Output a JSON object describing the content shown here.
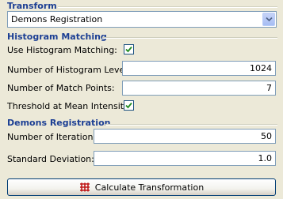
{
  "transform": {
    "title": "Transform",
    "selected": "Demons Registration"
  },
  "histogram": {
    "title": "Histogram Matching",
    "use_label": "Use Histogram Matching:",
    "use_checked": true,
    "levels_label": "Number of Histogram Levels:",
    "levels_value": "1024",
    "points_label": "Number of Match Points:",
    "points_value": "7",
    "threshold_label": "Threshold at Mean Intensity:",
    "threshold_checked": true
  },
  "demons": {
    "title": "Demons Registration",
    "iterations_label": "Number of Iterations:",
    "iterations_value": "50",
    "stddev_label": "Standard Deviation:",
    "stddev_value": "1.0"
  },
  "action": {
    "label": "Calculate Transformation",
    "icon": "grid-transform-icon",
    "icon_color": "#c01818"
  },
  "colors": {
    "section_title": "#1c3f94",
    "check": "#1f8a1f"
  }
}
